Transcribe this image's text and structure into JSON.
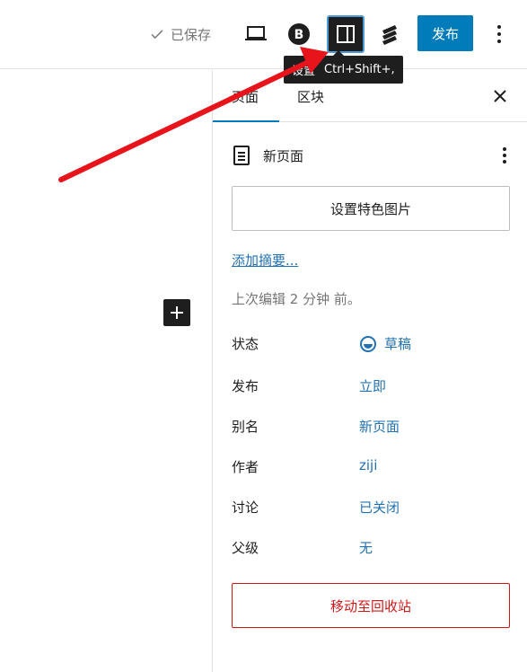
{
  "toolbar": {
    "saved_label": "已保存",
    "publish_label": "发布"
  },
  "tooltip": {
    "label": "设置",
    "shortcut": "Ctrl+Shift+,"
  },
  "sidebar": {
    "tabs": [
      {
        "label": "页面",
        "active": true
      },
      {
        "label": "区块",
        "active": false
      }
    ],
    "document_title": "新页面",
    "featured_image_label": "设置特色图片",
    "excerpt_link": "添加摘要...",
    "last_edited": "上次编辑 2 分钟 前。",
    "meta": [
      {
        "label": "状态",
        "value": "草稿",
        "icon": "draft-status-icon"
      },
      {
        "label": "发布",
        "value": "立即"
      },
      {
        "label": "别名",
        "value": "新页面"
      },
      {
        "label": "作者",
        "value": "ziji"
      },
      {
        "label": "讨论",
        "value": "已关闭"
      },
      {
        "label": "父级",
        "value": "无"
      }
    ],
    "trash_label": "移动至回收站"
  },
  "colors": {
    "accent": "#007cba",
    "link": "#2271b1",
    "danger": "#cc1818",
    "annotation_arrow": "#e8141c"
  }
}
